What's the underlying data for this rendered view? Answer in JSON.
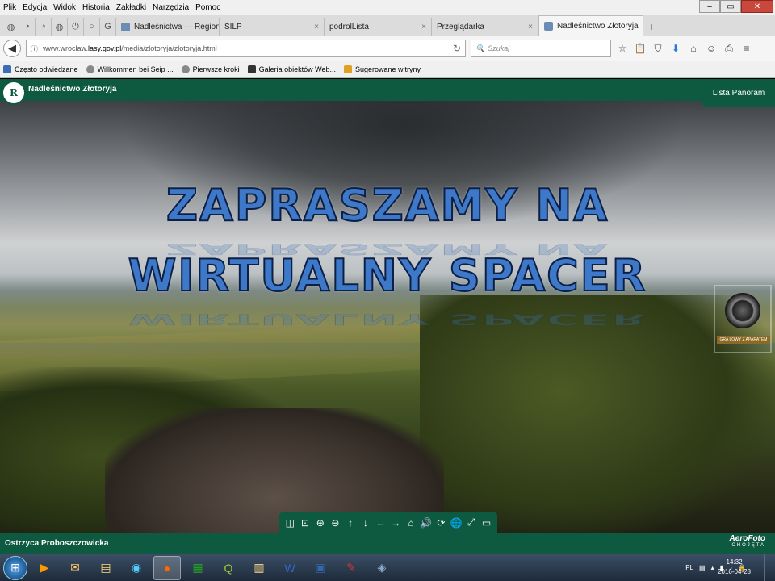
{
  "menu": [
    "Plik",
    "Edycja",
    "Widok",
    "Historia",
    "Zakładki",
    "Narzędzia",
    "Pomoc"
  ],
  "window_controls": {
    "minimize": "–",
    "maximize": "▭",
    "close": "✕"
  },
  "tabs": [
    {
      "label": "Nadleśnictwa — Regionaln...",
      "active": false
    },
    {
      "label": "SILP",
      "active": false
    },
    {
      "label": "podrolLista",
      "active": false
    },
    {
      "label": "Przeglądarka",
      "active": false
    },
    {
      "label": "Nadleśnictwo Złotoryja",
      "active": true
    }
  ],
  "new_tab": "+",
  "url": {
    "prefix": "www.wroclaw.",
    "domain": "lasy.gov.pl",
    "path": "/media/zlotoryja/zlotoryja.html"
  },
  "search": {
    "placeholder": "Szukaj"
  },
  "bookmarks": [
    "Często odwiedzane",
    "Willkommen bei Seip ...",
    "Pierwsze kroki",
    "Galeria obiektów Web...",
    "Sugerowane witryny"
  ],
  "site": {
    "logo_text": "R",
    "name": "Nadleśnictwo Złotoryja",
    "menu_label": "Lista Panoram",
    "headline1": "ZAPRASZAMY NA",
    "headline2": "WIRTUALNY SPACER",
    "camera_label": "GRA LOWY Z APARATEM",
    "location": "Ostrzyca Proboszczowicka",
    "credit": "AeroFoto",
    "credit_sub": "CHOJĘTA"
  },
  "pano_controls": [
    "◫",
    "⊡",
    "⊕",
    "⊖",
    "↑",
    "↓",
    "←",
    "→",
    "⌂",
    "🔊",
    "⟳",
    "🌐",
    "⤢",
    "▭"
  ],
  "taskbar": {
    "lang": "PL",
    "time": "14:32",
    "date": "2016-04-28"
  }
}
